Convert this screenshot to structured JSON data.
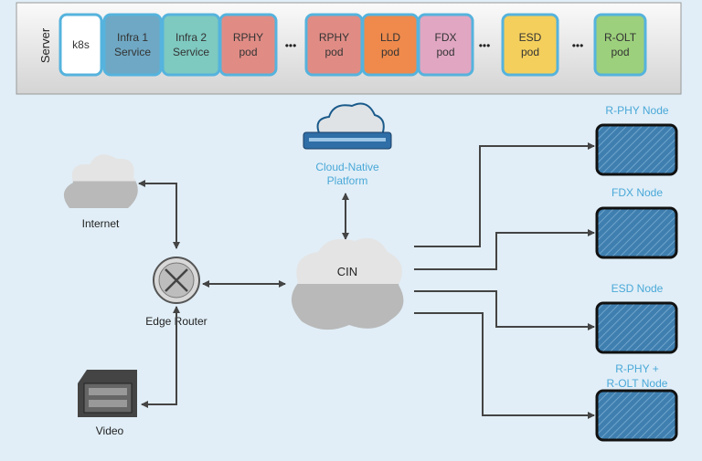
{
  "server": {
    "label": "Server",
    "pods": [
      {
        "line1": "k8s",
        "line2": "",
        "color": "#ffffff"
      },
      {
        "line1": "Infra 1",
        "line2": "Service",
        "color": "#6fa8c4"
      },
      {
        "line1": "Infra 2",
        "line2": "Service",
        "color": "#7ec9c0"
      },
      {
        "line1": "RPHY",
        "line2": "pod",
        "color": "#e08c85"
      },
      {
        "line1": "RPHY",
        "line2": "pod",
        "color": "#e08c85"
      },
      {
        "line1": "LLD",
        "line2": "pod",
        "color": "#ef8a4c"
      },
      {
        "line1": "FDX",
        "line2": "pod",
        "color": "#e0a6c2"
      },
      {
        "line1": "ESD",
        "line2": "pod",
        "color": "#f4cf5c"
      },
      {
        "line1": "R-OLT",
        "line2": "pod",
        "color": "#9cd07c"
      }
    ],
    "ellipsis": "•••"
  },
  "platform": {
    "line1": "Cloud-Native",
    "line2": "Platform"
  },
  "internet": "Internet",
  "edge_router": "Edge Router",
  "video": "Video",
  "cin": "CIN",
  "nodes": [
    {
      "line1": "R-PHY Node",
      "line2": ""
    },
    {
      "line1": "FDX Node",
      "line2": ""
    },
    {
      "line1": "ESD Node",
      "line2": ""
    },
    {
      "line1": "R-PHY +",
      "line2": "R-OLT Node"
    }
  ],
  "colors": {
    "label_blue": "#4aa8d8",
    "node_fill": "#3f7fb0",
    "pod_border": "#55b3dd",
    "line": "#444444"
  }
}
